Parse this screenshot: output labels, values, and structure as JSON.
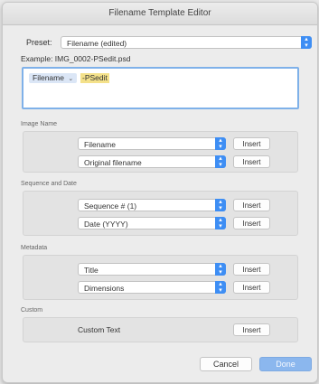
{
  "window": {
    "title": "Filename Template Editor"
  },
  "preset": {
    "label": "Preset:",
    "value": "Filename (edited)"
  },
  "example": {
    "text": "Example: IMG_0002-PSedit.psd"
  },
  "editor": {
    "token_label": "Filename",
    "token_chevron": "⌄",
    "typed_text": "-PSedit"
  },
  "image_name": {
    "heading": "Image Name",
    "rows": [
      {
        "value": "Filename",
        "button": "Insert"
      },
      {
        "value": "Original filename",
        "button": "Insert"
      }
    ]
  },
  "sequence_date": {
    "heading": "Sequence and Date",
    "rows": [
      {
        "value": "Sequence # (1)",
        "button": "Insert"
      },
      {
        "value": "Date (YYYY)",
        "button": "Insert"
      }
    ]
  },
  "metadata": {
    "heading": "Metadata",
    "rows": [
      {
        "value": "Title",
        "button": "Insert"
      },
      {
        "value": "Dimensions",
        "button": "Insert"
      }
    ]
  },
  "custom": {
    "heading": "Custom",
    "label": "Custom Text",
    "button": "Insert"
  },
  "footer": {
    "cancel": "Cancel",
    "done": "Done"
  },
  "colors": {
    "accent": "#3e8ef4",
    "token_bg": "#dbe6f6",
    "typed_bg": "#f4e18a",
    "done_bg": "#8bb7ee"
  },
  "icons": {
    "stepper": "up-down-chevron-icon"
  }
}
